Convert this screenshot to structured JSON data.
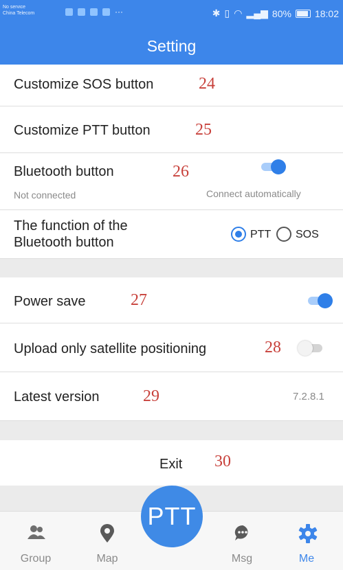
{
  "status_bar": {
    "carrier_line1": "No service",
    "carrier_line2": "China Telecom",
    "battery": "80%",
    "time": "18:02"
  },
  "header": {
    "title": "Setting"
  },
  "settings": {
    "customize_sos": {
      "label": "Customize SOS button",
      "annotation": "24"
    },
    "customize_ptt": {
      "label": "Customize PTT button",
      "annotation": "25"
    },
    "bluetooth": {
      "label": "Bluetooth button",
      "annotation": "26",
      "status": "Not connected",
      "auto_label": "Connect automatically",
      "auto_on": true
    },
    "bt_function": {
      "label_line1": "The function of the",
      "label_line2": "Bluetooth button",
      "option_ptt": "PTT",
      "option_sos": "SOS",
      "selected": "PTT"
    },
    "power_save": {
      "label": "Power save",
      "annotation": "27",
      "on": true
    },
    "satellite_only": {
      "label": "Upload only satellite positioning",
      "annotation": "28",
      "on": false
    },
    "version": {
      "label": "Latest version",
      "annotation": "29",
      "value": "7.2.8.1"
    },
    "exit": {
      "label": "Exit",
      "annotation": "30"
    }
  },
  "ptt_button": {
    "label": "PTT"
  },
  "nav": {
    "items": [
      {
        "label": "Group",
        "icon": "group-icon"
      },
      {
        "label": "Map",
        "icon": "map-pin-icon"
      },
      {
        "label": "Msg",
        "icon": "message-icon"
      },
      {
        "label": "Me",
        "icon": "gear-icon",
        "active": true
      }
    ]
  },
  "colors": {
    "primary": "#3d86ea",
    "annotation_red": "#c8413b",
    "background": "#ebebeb"
  }
}
